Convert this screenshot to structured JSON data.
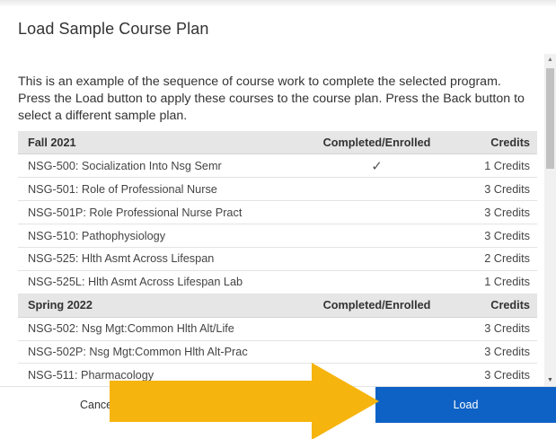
{
  "dialog": {
    "title": "Load Sample Course Plan",
    "description": "This is an example of the sequence of course work to complete the selected program. Press the Load button to apply these courses to the course plan. Press the Back button to select a different sample plan."
  },
  "terms": [
    {
      "name": "Fall 2021",
      "col_completed": "Completed/Enrolled",
      "col_credits": "Credits",
      "courses": [
        {
          "course": "NSG-500: Socialization Into Nsg Semr",
          "completed": "✓",
          "credits": "1 Credits"
        },
        {
          "course": "NSG-501: Role of Professional Nurse",
          "completed": "",
          "credits": "3 Credits"
        },
        {
          "course": "NSG-501P: Role Professional Nurse Pract",
          "completed": "",
          "credits": "3 Credits"
        },
        {
          "course": "NSG-510: Pathophysiology",
          "completed": "",
          "credits": "3 Credits"
        },
        {
          "course": "NSG-525: Hlth Asmt Across Lifespan",
          "completed": "",
          "credits": "2 Credits"
        },
        {
          "course": "NSG-525L: Hlth Asmt Across Lifespan Lab",
          "completed": "",
          "credits": "1 Credits"
        }
      ]
    },
    {
      "name": "Spring 2022",
      "col_completed": "Completed/Enrolled",
      "col_credits": "Credits",
      "courses": [
        {
          "course": "NSG-502: Nsg Mgt:Common Hlth Alt/Life",
          "completed": "",
          "credits": "3 Credits"
        },
        {
          "course": "NSG-502P: Nsg Mgt:Common Hlth Alt-Prac",
          "completed": "",
          "credits": "3 Credits"
        },
        {
          "course": "NSG-511: Pharmacology",
          "completed": "",
          "credits": "3 Credits"
        }
      ]
    }
  ],
  "footer": {
    "cancel_label": "Cancel",
    "load_label": "Load"
  },
  "icons": {
    "check": "checkmark-icon",
    "scroll_up": "scroll-up-arrow-icon",
    "scroll_down": "scroll-down-arrow-icon",
    "overlay_arrow": "right-arrow-annotation-icon"
  },
  "colors": {
    "load_button": "#0f62c5",
    "table_header": "#e6e6e6",
    "annotation_arrow": "#f6b40e"
  }
}
